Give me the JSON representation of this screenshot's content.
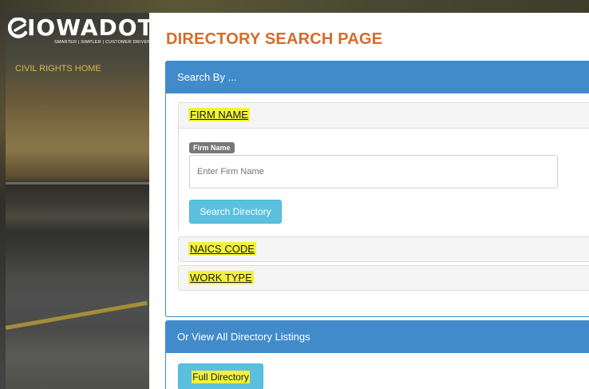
{
  "brand": {
    "logo_text": "IOWADOT",
    "tagline": "SMARTER | SIMPLER | CUSTOMER DRIVEN"
  },
  "sidebar": {
    "items": [
      {
        "label": "CIVIL RIGHTS HOME"
      }
    ]
  },
  "main": {
    "title": "DIRECTORY SEARCH PAGE",
    "search_panel": {
      "heading": "Search By ...",
      "sections": [
        {
          "label": "FIRM NAME",
          "field_label": "Firm Name",
          "input_value": "",
          "input_placeholder": "Enter Firm Name",
          "button_label": "Search Directory"
        },
        {
          "label": "NAICS CODE"
        },
        {
          "label": "WORK TYPE"
        }
      ]
    },
    "view_all_panel": {
      "heading": "Or View All Directory Listings",
      "button_label": "Full Directory"
    }
  },
  "colors": {
    "title_orange": "#d66b2a",
    "panel_blue": "#428bca",
    "button_cyan": "#5bc0de",
    "highlight_yellow": "#f3f23a",
    "nav_gold": "#d8b84a"
  }
}
